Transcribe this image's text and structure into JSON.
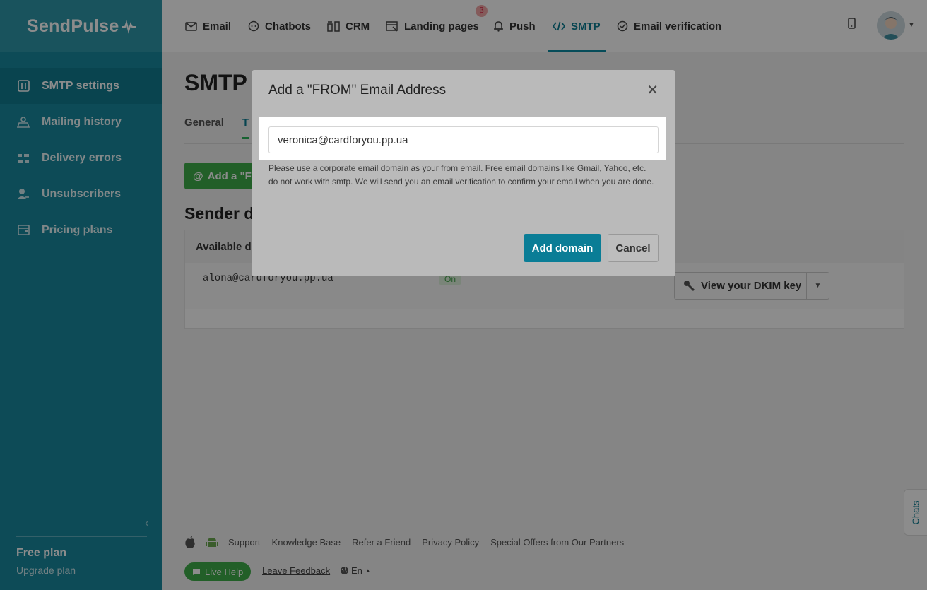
{
  "brand": {
    "logo_text": "SendPulse",
    "accent": "#18899e",
    "green": "#3fae49"
  },
  "topnav": {
    "items": [
      {
        "label": "Email",
        "icon": "envelope-icon"
      },
      {
        "label": "Chatbots",
        "icon": "chat-bubble-icon"
      },
      {
        "label": "CRM",
        "icon": "crm-icon"
      },
      {
        "label": "Landing pages",
        "icon": "landing-page-icon"
      },
      {
        "label": "Push",
        "icon": "bell-icon"
      },
      {
        "label": "SMTP",
        "icon": "code-icon"
      },
      {
        "label": "Email verification",
        "icon": "check-circle-icon"
      }
    ],
    "active": "SMTP",
    "beta_badge": "β"
  },
  "sidebar": {
    "items": [
      {
        "label": "SMTP settings",
        "icon": "settings-sliders-icon"
      },
      {
        "label": "Mailing history",
        "icon": "history-icon"
      },
      {
        "label": "Delivery errors",
        "icon": "errors-icon"
      },
      {
        "label": "Unsubscribers",
        "icon": "user-minus-icon"
      },
      {
        "label": "Pricing plans",
        "icon": "wallet-icon"
      }
    ],
    "active": "SMTP settings",
    "plan_name": "Free plan",
    "upgrade": "Upgrade plan"
  },
  "main": {
    "title": "SMTP",
    "tabs": [
      "General",
      "T"
    ],
    "add_button": "Add a \"F",
    "sender_title": "Sender d",
    "table_header": "Available do",
    "row": {
      "email": "alona@cardforyou.pp.ua",
      "status": "On",
      "dkim_button": "View your DKIM key"
    }
  },
  "footer": {
    "links": [
      "Support",
      "Knowledge Base",
      "Refer a Friend",
      "Privacy Policy",
      "Special Offers from Our Partners"
    ],
    "live_help": "Live Help",
    "leave_feedback": "Leave Feedback",
    "language": "En"
  },
  "chats_tab": "Chats",
  "modal": {
    "title": "Add a \"FROM\" Email Address",
    "email_value": "veronica@cardforyou.pp.ua",
    "hint": "Please use a corporate email domain as your from email. Free email domains like Gmail, Yahoo, etc. do not work with smtp. We will send you an email verification to confirm your email when you are done.",
    "primary_button": "Add domain",
    "cancel_button": "Cancel"
  }
}
